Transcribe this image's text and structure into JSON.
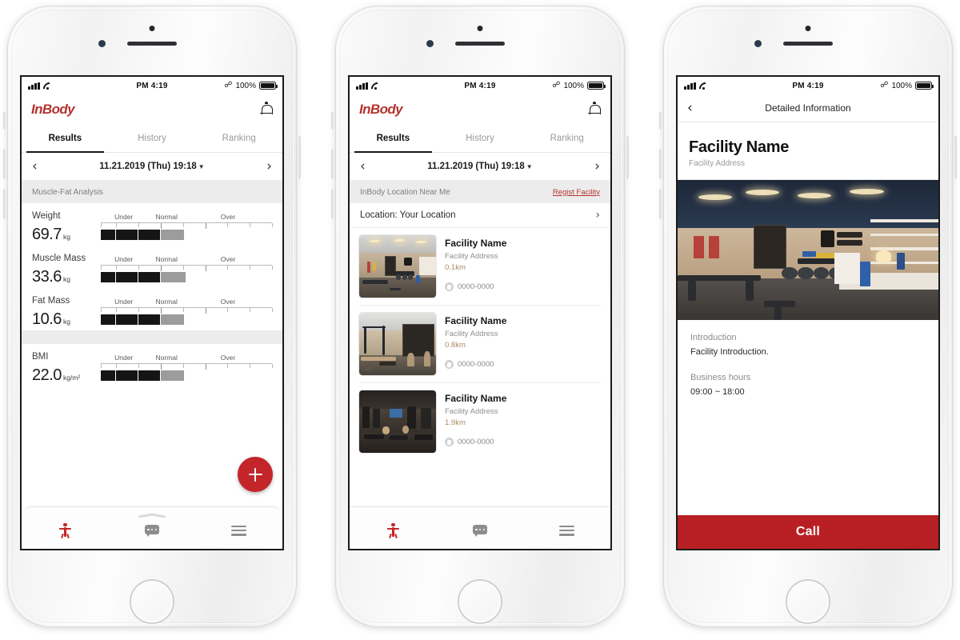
{
  "status_bar": {
    "time": "PM 4:19",
    "battery_percent": "100%",
    "signal_icon": "cellular-signal-icon",
    "wifi_icon": "wifi-icon",
    "bluetooth_icon": "bluetooth-icon",
    "battery_icon": "battery-icon"
  },
  "brand": {
    "logo_text": "InBody",
    "logo_color": "#b4342f",
    "accent_red": "#c3252a",
    "call_red": "#b81f24",
    "distance_color": "#a98a5e"
  },
  "phone1": {
    "app_bar": {
      "logo": "InBody",
      "bell_icon": "notification-bell-icon"
    },
    "tabs": [
      {
        "label": "Results",
        "active": true
      },
      {
        "label": "History",
        "active": false
      },
      {
        "label": "Ranking",
        "active": false
      }
    ],
    "date_bar": {
      "prev_icon": "chevron-left-icon",
      "next_icon": "chevron-right-icon",
      "date": "11.21.2019 (Thu) 19:18",
      "caret_icon": "caret-down-icon"
    },
    "section_title": "Muscle-Fat Analysis",
    "metrics": [
      {
        "name": "Weight",
        "value": "69.7",
        "unit": "kg",
        "labels": [
          "Under",
          "Normal",
          "Over"
        ],
        "segments": [
          {
            "w": 9,
            "tone": "dark"
          },
          {
            "w": 13,
            "tone": "dark"
          },
          {
            "w": 13,
            "tone": "dark"
          },
          {
            "w": 14,
            "tone": "gray"
          }
        ]
      },
      {
        "name": "Muscle Mass",
        "value": "33.6",
        "unit": "kg",
        "labels": [
          "Under",
          "Normal",
          "Over"
        ],
        "segments": [
          {
            "w": 9,
            "tone": "dark"
          },
          {
            "w": 13,
            "tone": "dark"
          },
          {
            "w": 13,
            "tone": "dark"
          },
          {
            "w": 15,
            "tone": "gray"
          }
        ]
      },
      {
        "name": "Fat Mass",
        "value": "10.6",
        "unit": "kg",
        "labels": [
          "Under",
          "Normal",
          "Over"
        ],
        "segments": [
          {
            "w": 9,
            "tone": "dark"
          },
          {
            "w": 13,
            "tone": "dark"
          },
          {
            "w": 13,
            "tone": "dark"
          },
          {
            "w": 14,
            "tone": "gray"
          }
        ]
      },
      {
        "name": "BMI",
        "value": "22.0",
        "unit": "kg/m²",
        "labels": [
          "Under",
          "Normal",
          "Over"
        ],
        "segments": [
          {
            "w": 9,
            "tone": "dark"
          },
          {
            "w": 13,
            "tone": "dark"
          },
          {
            "w": 13,
            "tone": "dark"
          },
          {
            "w": 14,
            "tone": "gray"
          }
        ]
      }
    ],
    "fab": {
      "icon": "plus-icon"
    },
    "tab_bar": [
      {
        "icon": "body-figure-icon",
        "active": true
      },
      {
        "icon": "chat-bubble-icon",
        "active": false
      },
      {
        "icon": "hamburger-menu-icon",
        "active": false
      }
    ]
  },
  "phone2": {
    "app_bar": {
      "logo": "InBody",
      "bell_icon": "notification-bell-icon"
    },
    "tabs": [
      {
        "label": "Results",
        "active": true
      },
      {
        "label": "History",
        "active": false
      },
      {
        "label": "Ranking",
        "active": false
      }
    ],
    "date_bar": {
      "prev_icon": "chevron-left-icon",
      "next_icon": "chevron-right-icon",
      "date": "11.21.2019 (Thu) 19:18",
      "caret_icon": "caret-down-icon"
    },
    "section_title": "InBody Location Near Me",
    "register_link": "Regist Facility",
    "location_row": {
      "label": "Location: Your Location",
      "chevron_icon": "chevron-right-icon"
    },
    "facilities": [
      {
        "name": "Facility Name",
        "address": "Facility Address",
        "distance": "0.1km",
        "phone": "0000-0000",
        "phone_icon": "phone-icon",
        "photo": "gym-interior-bright"
      },
      {
        "name": "Facility Name",
        "address": "Facility Address",
        "distance": "0.8km",
        "phone": "0000-0000",
        "phone_icon": "phone-icon",
        "photo": "gym-interior-open"
      },
      {
        "name": "Facility Name",
        "address": "Facility Address",
        "distance": "1.9km",
        "phone": "0000-0000",
        "phone_icon": "phone-icon",
        "photo": "gym-interior-dark"
      }
    ],
    "tab_bar": [
      {
        "icon": "body-figure-icon",
        "active": true
      },
      {
        "icon": "chat-bubble-icon",
        "active": false
      },
      {
        "icon": "hamburger-menu-icon",
        "active": false
      }
    ]
  },
  "phone3": {
    "nav": {
      "back_icon": "chevron-left-icon",
      "title": "Detailed Information"
    },
    "facility": {
      "name": "Facility Name",
      "address": "Facility Address",
      "photo": "gym-interior-eight-body"
    },
    "details": [
      {
        "label": "Introduction",
        "value": "Facility Introduction."
      },
      {
        "label": "Business hours",
        "value": "09:00 ~ 18:00"
      }
    ],
    "call_button": "Call"
  }
}
